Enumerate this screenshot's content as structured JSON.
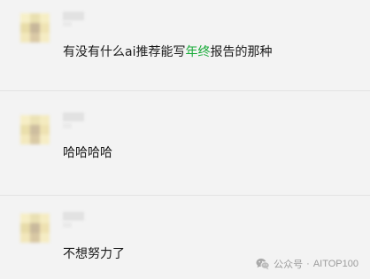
{
  "comments": [
    {
      "text_before": "有没有什么ai推荐能写",
      "text_highlight": "年终",
      "text_after": "报告的那种"
    },
    {
      "text": "哈哈哈哈"
    },
    {
      "text": "不想努力了"
    }
  ],
  "watermark": {
    "account": "公众号",
    "separator": "·",
    "name": "AITOP100",
    "icon": "wechat-icon"
  },
  "colors": {
    "background": "#f3f3f3",
    "highlight": "#1aab3a",
    "divider": "#e3e3e3"
  }
}
